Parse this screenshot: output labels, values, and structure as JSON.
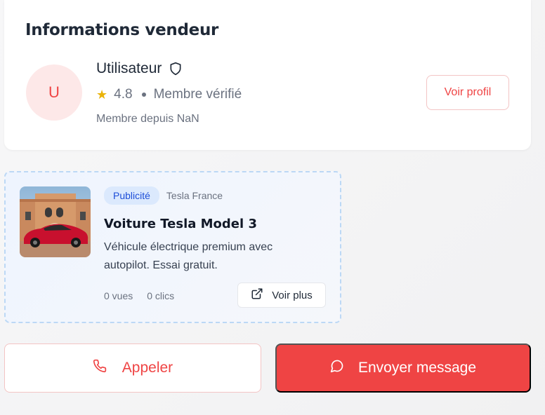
{
  "seller": {
    "section_title": "Informations vendeur",
    "avatar_initial": "U",
    "name": "Utilisateur",
    "rating": "4.8",
    "verified_label": "Membre vérifié",
    "member_since": "Membre depuis NaN",
    "profile_button": "Voir profil"
  },
  "ad": {
    "badge": "Publicité",
    "brand": "Tesla France",
    "title": "Voiture Tesla Model 3",
    "description": "Véhicule électrique premium avec autopilot. Essai gratuit.",
    "views": "0 vues",
    "clicks": "0 clics",
    "more_button": "Voir plus"
  },
  "actions": {
    "call_button": "Appeler",
    "message_button": "Envoyer message"
  },
  "colors": {
    "accent": "#ef4444",
    "ad_badge": "#1d4ed8",
    "star": "#eab308"
  },
  "icons": [
    "shield-icon",
    "star-icon",
    "external-link-icon",
    "phone-icon",
    "message-circle-icon"
  ]
}
